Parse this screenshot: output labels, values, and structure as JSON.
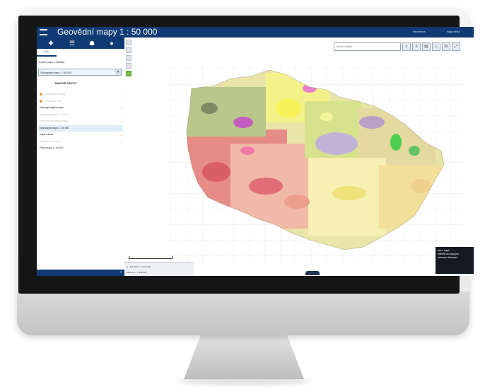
{
  "app": {
    "title": "Geovědní mapy 1 : 50 000",
    "header_links": [
      "Informace",
      "Nápověda"
    ]
  },
  "sidebar": {
    "tab_icons": [
      "plus-icon",
      "filter-icon",
      "binoculars-icon",
      "info-icon"
    ],
    "subtab": "Mapy",
    "heading": "Zvolte mapu z nabídky",
    "select_value": "Geologická mapa 1 : 50 000",
    "section_label": "MAPOVÉ VRSTVY",
    "layers": [
      {
        "label": "Geologické jednotky",
        "state": "muted",
        "dot": true
      },
      {
        "label": "Geologické linie",
        "state": "muted",
        "dot": true
      },
      {
        "label": "Hydrogeologická mapa",
        "state": "normal",
        "dot": false
      },
      {
        "label": "Mapa geofaktorů 1 : 50 000",
        "state": "muted",
        "dot": false
      },
      {
        "label": "Inženýrskogeologická mapa",
        "state": "muted",
        "dot": false
      },
      {
        "label": "Geologická mapa 1 : 50 000",
        "state": "active",
        "dot": false
      },
      {
        "label": "Mapa ložisek",
        "state": "normal",
        "dot": false
      },
      {
        "label": "Mapa geochemická",
        "state": "muted",
        "dot": false
      },
      {
        "label": "Půdní mapa 1 : 50 000",
        "state": "normal",
        "dot": false
      }
    ]
  },
  "map": {
    "search_placeholder": "Hledat lokalitu",
    "tool_icons": [
      "search-icon",
      "layers-icon",
      "print-icon",
      "measure-icon",
      "settings-icon",
      "fullscreen-icon"
    ],
    "coords": [
      "X: -741 253   Y: -1 043 118",
      "Měřítko 1 : 1 800 000"
    ],
    "popup": [
      "Info o mapě",
      "Klikněte do mapy pro",
      "zobrazení informací"
    ]
  },
  "colors": {
    "header": "#0f3a73",
    "accent": "#7bc24a"
  }
}
